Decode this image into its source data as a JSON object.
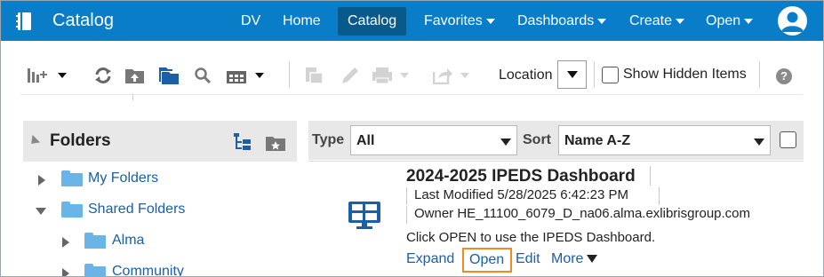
{
  "app": {
    "title": "Catalog"
  },
  "nav": {
    "items": [
      {
        "label": "DV",
        "active": false,
        "dropdown": false
      },
      {
        "label": "Home",
        "active": false,
        "dropdown": false
      },
      {
        "label": "Catalog",
        "active": true,
        "dropdown": false
      },
      {
        "label": "Favorites",
        "active": false,
        "dropdown": true
      },
      {
        "label": "Dashboards",
        "active": false,
        "dropdown": true
      },
      {
        "label": "Create",
        "active": false,
        "dropdown": true
      },
      {
        "label": "Open",
        "active": false,
        "dropdown": true
      }
    ]
  },
  "toolbar": {
    "location_label": "Location",
    "show_hidden_label": "Show Hidden Items",
    "show_hidden_checked": false,
    "help_icon": "help-icon"
  },
  "folders": {
    "title": "Folders",
    "items": [
      {
        "label": "My Folders",
        "expanded": false
      },
      {
        "label": "Shared Folders",
        "expanded": true
      },
      {
        "label": "Alma",
        "expanded": false
      },
      {
        "label": "Community",
        "expanded": false
      }
    ]
  },
  "filters": {
    "type_label": "Type",
    "type_value": "All",
    "sort_label": "Sort",
    "sort_value": "Name A-Z"
  },
  "result": {
    "title": "2024-2025 IPEDS Dashboard",
    "last_modified": "Last Modified 5/28/2025 6:42:23 PM",
    "owner": "Owner HE_11100_6079_D_na06.alma.exlibrisgroup.com",
    "description": "Click OPEN to use the IPEDS Dashboard.",
    "links": {
      "expand": "Expand",
      "open": "Open",
      "edit": "Edit",
      "more": "More"
    }
  },
  "colors": {
    "header_bg": "#0a7dc9",
    "active_tab_bg": "#085a8c",
    "link": "#1a5fa8",
    "highlight": "#f08a24"
  }
}
